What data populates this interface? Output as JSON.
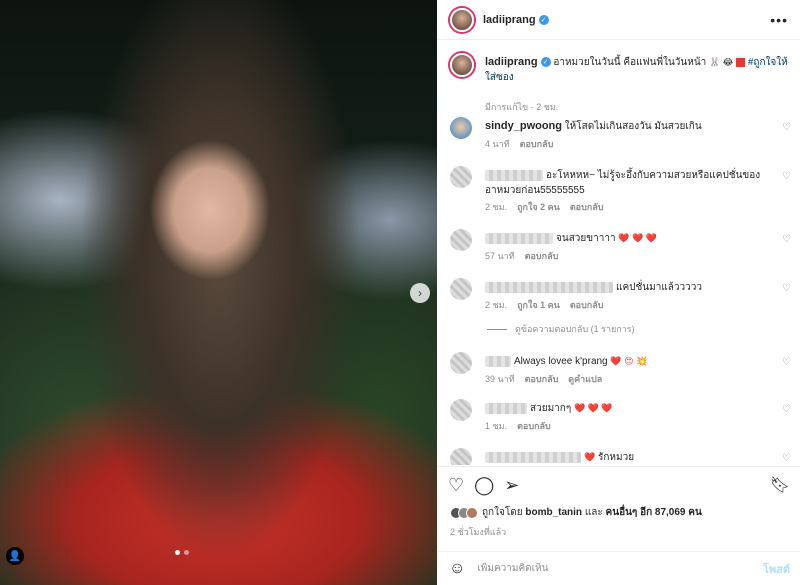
{
  "post": {
    "username": "ladiiprang",
    "caption_text": "อาหมวยในวันนี้ คือแฟนพี่ในวันหน้า",
    "caption_emojis": "🐰 😂",
    "hashtag": "#ถูกใจให้ใส่ซอง",
    "edited_label": "มีการแก้ไข",
    "caption_time": "2 ชม."
  },
  "comments": [
    {
      "username": "sindy_pwoong",
      "text": "ให้โสดไม่เกินสองวัน มันสวยเกิน",
      "time": "4 นาที",
      "likes": "",
      "reply": "ตอบกลับ"
    },
    {
      "username": "",
      "text": "อะโหหหห~ ไม่รู้จะอึ้งกับความสวยหรือแคปชั่นของอาหมวยก่อน55555555",
      "time": "2 ชม.",
      "likes": "ถูกใจ 2 คน",
      "reply": "ตอบกลับ"
    },
    {
      "username": "",
      "text": "จนสวยขาาาา",
      "emoji": "❤️ ❤️ ❤️",
      "time": "57 นาที",
      "likes": "",
      "reply": "ตอบกลับ"
    },
    {
      "username": "",
      "text": "แคปชั่นมาแล้ววววว",
      "time": "2 ชม.",
      "likes": "ถูกใจ 1 คน",
      "reply": "ตอบกลับ"
    },
    {
      "username": "",
      "text": "Always lovee k'prang",
      "emoji": "❤️ 😍 💥",
      "time": "39 นาที",
      "likes": "",
      "reply": "ตอบกลับ",
      "translate": "ดูคำแปล"
    },
    {
      "username": "",
      "text": "สวยมากๆ",
      "emoji": "❤️ ❤️ ❤️",
      "time": "1 ชม.",
      "likes": "",
      "reply": "ตอบกลับ"
    },
    {
      "username": "",
      "text": "รักหมวย",
      "emoji": "❤️",
      "time": "",
      "likes": "",
      "reply": ""
    }
  ],
  "view_replies": "ดูข้อความตอบกลับ (1 รายการ)",
  "likes": {
    "prefix": "ถูกใจโดย",
    "liker": "bomb_tanin",
    "middle": "และ",
    "others": "คนอื่นๆ อีก 87,069 คน"
  },
  "time_ago": "2 ชั่วโมงที่แล้ว",
  "comment_box": {
    "placeholder": "เพิ่มความคิดเห็น",
    "post_label": "โพสต์"
  },
  "colors": {
    "verified": "#3897f0",
    "link": "#00376b",
    "muted": "#8e8e8e",
    "post_disabled": "#b2dffc",
    "heart_red": "#ed4956"
  },
  "icons": [
    "more-options-icon",
    "verified-badge-icon",
    "like-heart-icon",
    "comment-icon",
    "share-icon",
    "bookmark-icon",
    "emoji-icon",
    "next-arrow-icon",
    "user-tag-icon"
  ]
}
